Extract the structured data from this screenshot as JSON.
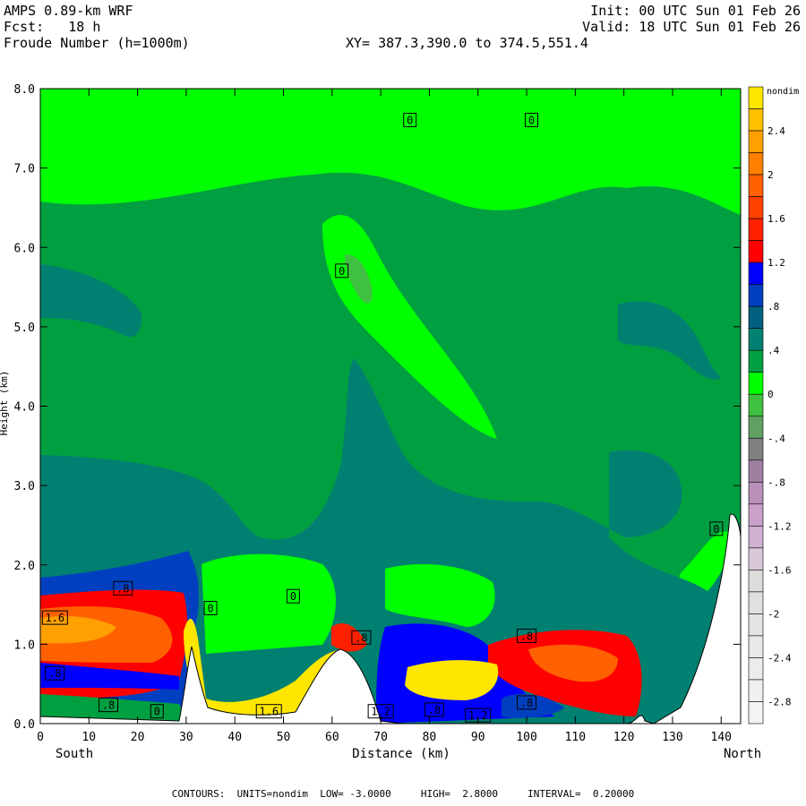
{
  "header": {
    "line1_left": "AMPS 0.89-km WRF",
    "line2_left": "Fcst:   18 h",
    "line3_left": "Froude Number (h=1000m)",
    "line1_right": "Init: 00 UTC Sun 01 Feb 26",
    "line2_right": "Valid: 18 UTC Sun 01 Feb 26",
    "xy_text": "XY= 387.3,390.0 to 374.5,551.4"
  },
  "chart_data": {
    "type": "heatmap",
    "title": "Froude Number (h=1000m)",
    "xlabel": "Distance (km)",
    "ylabel": "Height (km)",
    "xlim": [
      0,
      144
    ],
    "ylim": [
      0,
      8
    ],
    "x_ticks": [
      "0",
      "10",
      "20",
      "30",
      "40",
      "50",
      "60",
      "70",
      "80",
      "90",
      "100",
      "110",
      "120",
      "130",
      "140"
    ],
    "y_ticks": [
      "0.0",
      "1.0",
      "2.0",
      "3.0",
      "4.0",
      "5.0",
      "6.0",
      "7.0",
      "8.0"
    ],
    "x_end_labels": {
      "left": "South",
      "right": "North"
    },
    "units": "nondim",
    "colorbar": {
      "label": "nondim",
      "levels": [
        {
          "label": "",
          "color": "#ffe600"
        },
        {
          "label": "2.4",
          "color": "#ffc000"
        },
        {
          "label": "",
          "color": "#ffa000"
        },
        {
          "label": "2",
          "color": "#ff8000"
        },
        {
          "label": "",
          "color": "#ff6000"
        },
        {
          "label": "1.6",
          "color": "#ff4000"
        },
        {
          "label": "",
          "color": "#ff2000"
        },
        {
          "label": "1.2",
          "color": "#ff0000"
        },
        {
          "label": "",
          "color": "#0000ff"
        },
        {
          "label": ".8",
          "color": "#0040c0"
        },
        {
          "label": "",
          "color": "#006080"
        },
        {
          "label": ".4",
          "color": "#008070"
        },
        {
          "label": "",
          "color": "#00a040"
        },
        {
          "label": "0",
          "color": "#00ff00"
        },
        {
          "label": "",
          "color": "#40c040"
        },
        {
          "label": "-.4",
          "color": "#60a060"
        },
        {
          "label": "",
          "color": "#808080"
        },
        {
          "label": "-.8",
          "color": "#a080a0"
        },
        {
          "label": "",
          "color": "#b890b8"
        },
        {
          "label": "-1.2",
          "color": "#c8a0c8"
        },
        {
          "label": "",
          "color": "#d0b0d0"
        },
        {
          "label": "-1.6",
          "color": "#d8c8d8"
        },
        {
          "label": "",
          "color": "#dcdcdc"
        },
        {
          "label": "-2",
          "color": "#e0e0e0"
        },
        {
          "label": "",
          "color": "#e4e4e4"
        },
        {
          "label": "-2.4",
          "color": "#e8e8e8"
        },
        {
          "label": "",
          "color": "#ececec"
        },
        {
          "label": "-2.8",
          "color": "#f0f0f0"
        },
        {
          "label": "",
          "color": "#f4f4f4"
        }
      ]
    },
    "contour_labels": [
      {
        "x": 76,
        "y": 7.6,
        "text": "0"
      },
      {
        "x": 101,
        "y": 7.6,
        "text": "0"
      },
      {
        "x": 62,
        "y": 5.7,
        "text": "0"
      },
      {
        "x": 139,
        "y": 2.45,
        "text": "0"
      },
      {
        "x": 35,
        "y": 1.45,
        "text": "0"
      },
      {
        "x": 52,
        "y": 1.6,
        "text": "0"
      },
      {
        "x": 17,
        "y": 1.7,
        "text": ".8"
      },
      {
        "x": 3,
        "y": 1.33,
        "text": "1.6"
      },
      {
        "x": 3,
        "y": 0.63,
        "text": ".8"
      },
      {
        "x": 14,
        "y": 0.23,
        "text": ".8"
      },
      {
        "x": 24,
        "y": 0.15,
        "text": "0"
      },
      {
        "x": 47,
        "y": 0.15,
        "text": "1.6"
      },
      {
        "x": 66,
        "y": 1.08,
        "text": ".8"
      },
      {
        "x": 70,
        "y": 0.15,
        "text": "1.2"
      },
      {
        "x": 81,
        "y": 0.17,
        "text": ".8"
      },
      {
        "x": 90,
        "y": 0.1,
        "text": "1.2"
      },
      {
        "x": 100,
        "y": 1.1,
        "text": ".8"
      },
      {
        "x": 100,
        "y": 0.26,
        "text": ".8"
      }
    ],
    "footer": {
      "contours": "CONTOURS:  UNITS=nondim  LOW= -3.0000     HIGH=  2.8000     INTERVAL=  0.20000"
    }
  }
}
